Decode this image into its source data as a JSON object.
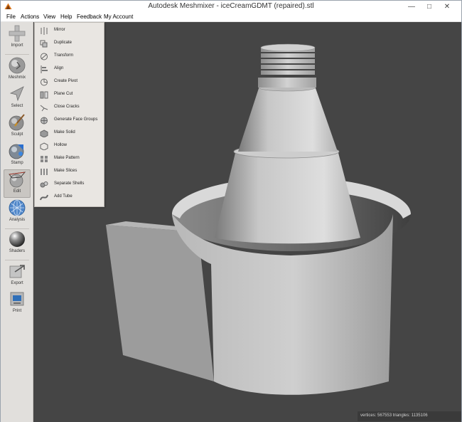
{
  "window": {
    "title": "Autodesk Meshmixer - iceCreamGDMT (repaired).stl"
  },
  "menubar": [
    "File",
    "Actions",
    "View",
    "Help",
    "Feedback",
    "My Account"
  ],
  "toolbar": [
    {
      "label": "Import",
      "icon": "plus-icon"
    },
    {
      "label": "Meshmix",
      "icon": "meshmix-icon"
    },
    {
      "label": "Select",
      "icon": "cursor-icon"
    },
    {
      "label": "Sculpt",
      "icon": "brush-icon"
    },
    {
      "label": "Stamp",
      "icon": "stamp-icon"
    },
    {
      "label": "Edit",
      "icon": "edit-icon",
      "active": true
    },
    {
      "label": "Analysis",
      "icon": "analysis-icon"
    },
    {
      "label": "Shaders",
      "icon": "shader-sphere-icon"
    },
    {
      "label": "Export",
      "icon": "export-icon"
    },
    {
      "label": "Print",
      "icon": "printer-icon"
    }
  ],
  "edit_menu": [
    {
      "label": "Mirror",
      "icon": "mirror-icon"
    },
    {
      "label": "Duplicate",
      "icon": "duplicate-icon"
    },
    {
      "label": "Transform",
      "icon": "transform-icon"
    },
    {
      "label": "Align",
      "icon": "align-icon"
    },
    {
      "label": "Create Pivot",
      "icon": "pivot-icon"
    },
    {
      "label": "Plane Cut",
      "icon": "plane-cut-icon"
    },
    {
      "label": "Close Cracks",
      "icon": "close-cracks-icon"
    },
    {
      "label": "Generate Face Groups",
      "icon": "face-groups-icon"
    },
    {
      "label": "Make Solid",
      "icon": "solid-icon"
    },
    {
      "label": "Hollow",
      "icon": "hollow-icon"
    },
    {
      "label": "Make Pattern",
      "icon": "pattern-icon"
    },
    {
      "label": "Make Slices",
      "icon": "slices-icon"
    },
    {
      "label": "Separate Shells",
      "icon": "shells-icon"
    },
    {
      "label": "Add Tube",
      "icon": "tube-icon"
    }
  ],
  "status": {
    "text": "vertices: 567553 triangles: 1135106"
  },
  "colors": {
    "viewport_bg": "#454545",
    "model": "#c8c8c8",
    "toolbar_bg": "#e1dfdc",
    "menu_bg": "#e9e6e2"
  }
}
